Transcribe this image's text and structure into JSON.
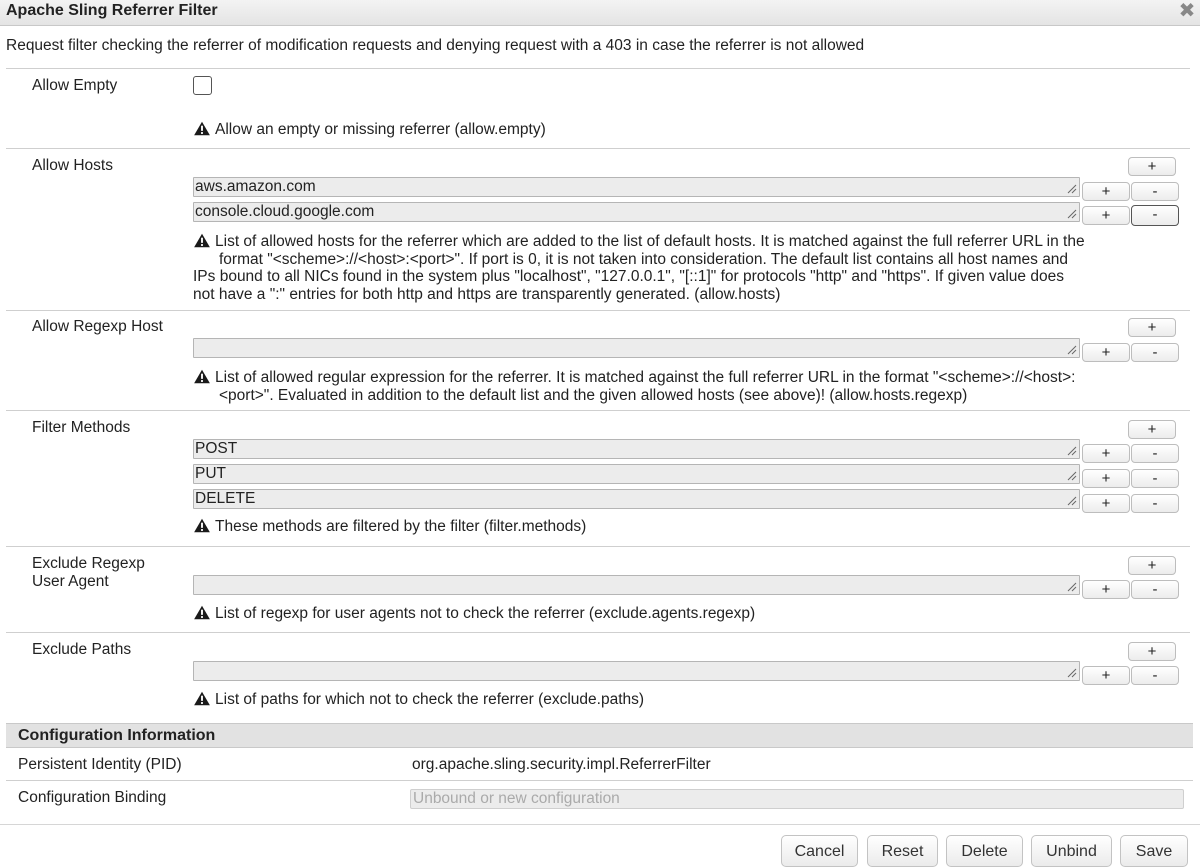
{
  "dialog": {
    "title": "Apache Sling Referrer Filter",
    "close_symbol": "✖",
    "description": "Request filter checking the referrer of modification requests and denying request with a 403 in case the referrer is not allowed"
  },
  "fields": {
    "allow_empty": {
      "label": "Allow Empty",
      "checked": false,
      "hint": "Allow an empty or missing referrer (allow.empty)"
    },
    "allow_hosts": {
      "label": "Allow Hosts",
      "values": [
        "aws.amazon.com",
        "console.cloud.google.com"
      ],
      "hint_line1": "List of allowed hosts for the referrer which are added to the list of default hosts. It is matched against the full referrer URL in the",
      "hint_line2": "format \"<scheme>://<host>:<port>\". If port is 0, it is not taken into consideration. The default list contains all host names and",
      "hint_line3": "IPs bound to all NICs found in the system plus \"localhost\", \"127.0.0.1\", \"[::1]\" for protocols \"http\" and \"https\". If given value does",
      "hint_line4": "not have a \":\" entries for both http and https are transparently generated. (allow.hosts)"
    },
    "allow_regexp_host": {
      "label": "Allow Regexp Host",
      "values": [
        ""
      ],
      "hint_line1": "List of allowed regular expression for the referrer. It is matched against the full referrer URL in the format \"<scheme>://<host>:",
      "hint_line2": "<port>\". Evaluated in addition to the default list and the given allowed hosts (see above)! (allow.hosts.regexp)"
    },
    "filter_methods": {
      "label": "Filter Methods",
      "values": [
        "POST",
        "PUT",
        "DELETE"
      ],
      "hint": "These methods are filtered by the filter (filter.methods)"
    },
    "exclude_agents": {
      "label_line1": "Exclude Regexp",
      "label_line2": "User Agent",
      "values": [
        ""
      ],
      "hint": "List of regexp for user agents not to check the referrer (exclude.agents.regexp)"
    },
    "exclude_paths": {
      "label": "Exclude Paths",
      "values": [
        ""
      ],
      "hint": "List of paths for which not to check the referrer (exclude.paths)"
    }
  },
  "buttons": {
    "plus": "+",
    "minus": "-"
  },
  "config_info": {
    "header": "Configuration Information",
    "pid_label": "Persistent Identity (PID)",
    "pid_value": "org.apache.sling.security.impl.ReferrerFilter",
    "binding_label": "Configuration Binding",
    "binding_placeholder": "Unbound or new configuration"
  },
  "footer": {
    "cancel": "Cancel",
    "reset": "Reset",
    "delete": "Delete",
    "unbind": "Unbind",
    "save": "Save"
  }
}
